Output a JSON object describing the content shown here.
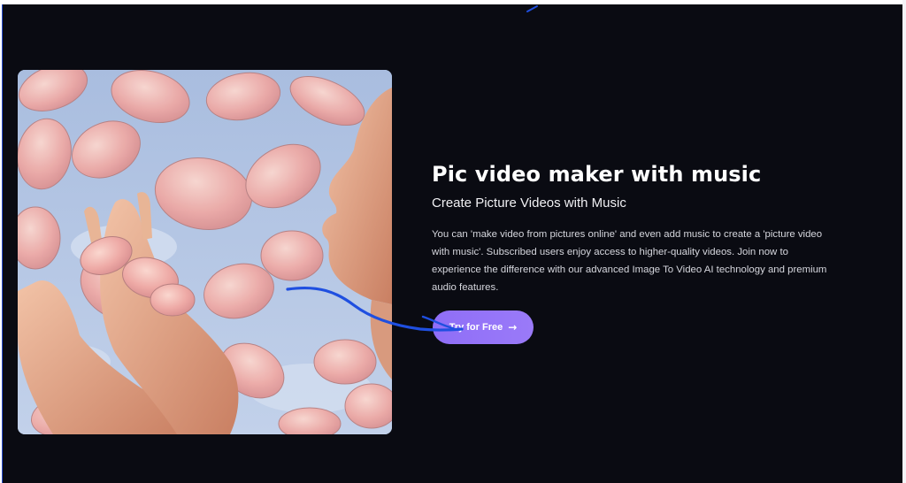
{
  "hero": {
    "title": "Pic video maker with music",
    "subtitle": "Create Picture Videos with Music",
    "description": "You can 'make video from pictures online' and even add music to create a 'picture video with music'. Subscribed users enjoy access to higher-quality videos. Join now to experience the difference with our advanced Image To Video AI technology and premium audio features.",
    "cta_label": "Try for Free",
    "cta_icon": "arrow-right-icon",
    "image_subject": "hands reaching toward pink petals against a blue sky"
  },
  "colors": {
    "page_background": "#0a0b12",
    "accent": "#9275f7",
    "annotation_stroke": "#1f4fe0",
    "petal": "#f0b7b2",
    "sky": "#9fb6d8"
  }
}
